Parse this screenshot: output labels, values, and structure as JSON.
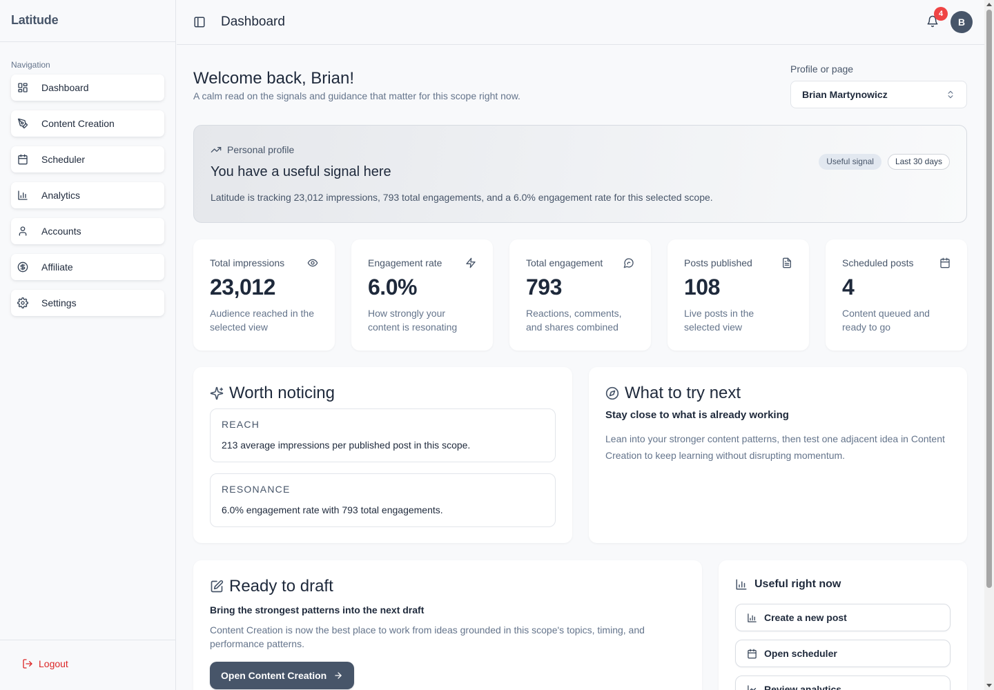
{
  "app": {
    "brand": "Latitude"
  },
  "sidebar": {
    "caption": "Navigation",
    "items": [
      {
        "label": "Dashboard",
        "icon": "layout-dashboard-icon"
      },
      {
        "label": "Content Creation",
        "icon": "pen-tool-icon"
      },
      {
        "label": "Scheduler",
        "icon": "calendar-icon"
      },
      {
        "label": "Analytics",
        "icon": "bar-chart-icon"
      },
      {
        "label": "Accounts",
        "icon": "user-icon"
      },
      {
        "label": "Affiliate",
        "icon": "dollar-circle-icon"
      },
      {
        "label": "Settings",
        "icon": "gear-icon"
      }
    ],
    "logout": "Logout"
  },
  "header": {
    "title": "Dashboard",
    "notification_count": "4",
    "avatar_initial": "B"
  },
  "welcome": {
    "title": "Welcome back, Brian!",
    "subtitle": "A calm read on the signals and guidance that matter for this scope right now."
  },
  "scope": {
    "label": "Profile or page",
    "value": "Brian Martynowicz"
  },
  "banner": {
    "kicker": "Personal profile",
    "title": "You have a useful signal here",
    "text": "Latitude is tracking 23,012 impressions, 793 total engagements, and a 6.0% engagement rate for this selected scope.",
    "chips": [
      "Useful signal",
      "Last 30 days"
    ]
  },
  "stats": [
    {
      "label": "Total impressions",
      "value": "23,012",
      "desc": "Audience reached in the selected view",
      "icon": "eye-icon"
    },
    {
      "label": "Engagement rate",
      "value": "6.0%",
      "desc": "How strongly your content is resonating",
      "icon": "lightning-icon"
    },
    {
      "label": "Total engagement",
      "value": "793",
      "desc": "Reactions, comments, and shares combined",
      "icon": "message-circle-icon"
    },
    {
      "label": "Posts published",
      "value": "108",
      "desc": "Live posts in the selected view",
      "icon": "document-icon"
    },
    {
      "label": "Scheduled posts",
      "value": "4",
      "desc": "Content queued and ready to go",
      "icon": "calendar-icon"
    }
  ],
  "worth_noticing": {
    "title": "Worth noticing",
    "items": [
      {
        "kicker": "REACH",
        "text": "213 average impressions per published post in this scope."
      },
      {
        "kicker": "RESONANCE",
        "text": "6.0% engagement rate with 793 total engagements."
      }
    ]
  },
  "try_next": {
    "title": "What to try next",
    "subtitle": "Stay close to what is already working",
    "text": "Lean into your stronger content patterns, then test one adjacent idea in Content Creation to keep learning without disrupting momentum."
  },
  "draft": {
    "title": "Ready to draft",
    "subtitle": "Bring the strongest patterns into the next draft",
    "text": "Content Creation is now the best place to work from ideas grounded in this scope's topics, timing, and performance patterns.",
    "button": "Open Content Creation"
  },
  "useful": {
    "title": "Useful right now",
    "actions": [
      "Create a new post",
      "Open scheduler",
      "Review analytics"
    ]
  }
}
